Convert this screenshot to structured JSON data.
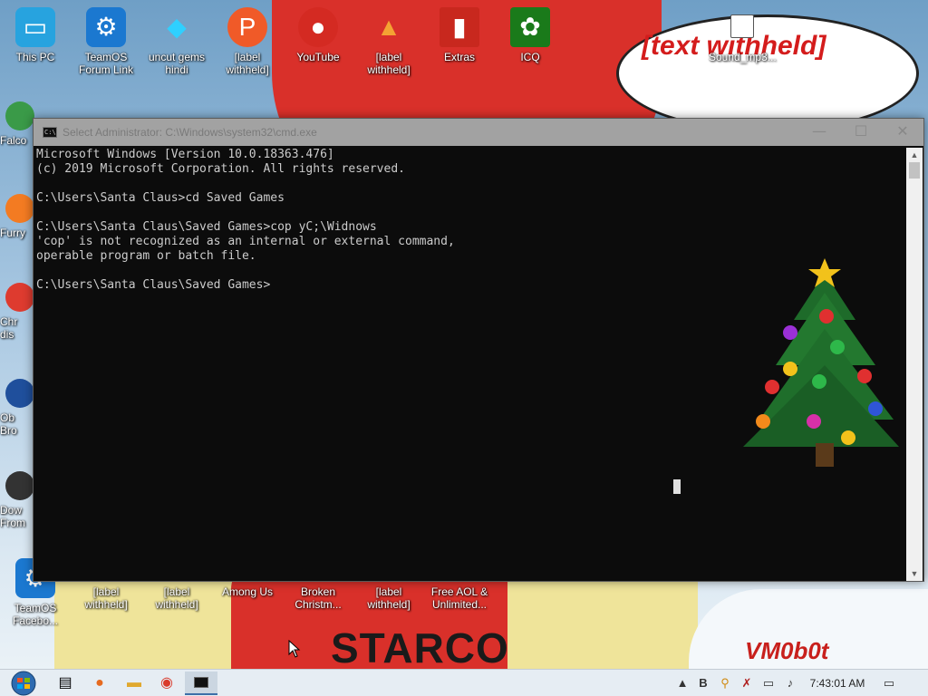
{
  "desktop": {
    "top_icons": [
      {
        "label": "This PC",
        "icon": "computer-icon"
      },
      {
        "label": "TeamOS Forum Link",
        "icon": "gear-icon"
      },
      {
        "label": "uncut gems hindi",
        "icon": "gem-icon"
      },
      {
        "label": "[label withheld]",
        "icon": "p-badge-icon"
      },
      {
        "label": "YouTube",
        "icon": "angry-bird-icon"
      },
      {
        "label": "[label withheld]",
        "icon": "ice-cream-icon"
      },
      {
        "label": "Extras",
        "icon": "red-book-icon"
      },
      {
        "label": "ICQ",
        "icon": "flower-icon"
      }
    ],
    "sound_icon": {
      "label": "Sound_mp3..."
    },
    "left_partial_icons": [
      {
        "label": "Falco"
      },
      {
        "label": "Furry"
      },
      {
        "label": "Chr dis"
      },
      {
        "label": "Ob Bro"
      },
      {
        "label": "Dow From"
      }
    ],
    "bottom_icons": [
      {
        "label": "TeamOS Facebo...",
        "icon": "gear-icon"
      },
      {
        "label": "[label withheld]",
        "icon": "app-icon"
      },
      {
        "label": "[label withheld]",
        "icon": "app-icon"
      },
      {
        "label": "Among Us",
        "icon": "game-icon"
      },
      {
        "label": "Broken Christm...",
        "icon": "ornament-icon"
      },
      {
        "label": "[label withheld]",
        "icon": "file-icon"
      },
      {
        "label": "Free AOL & Unlimited...",
        "icon": "aol-icon"
      }
    ]
  },
  "wallpaper": {
    "bubble_text": "[text withheld]",
    "signature": "VM0b0t",
    "banner_word": "STARCO"
  },
  "cmd_window": {
    "title": "Select Administrator: C:\\Windows\\system32\\cmd.exe",
    "minimize": "—",
    "maximize": "☐",
    "close": "✕",
    "lines": [
      "Microsoft Windows [Version 10.0.18363.476]",
      "(c) 2019 Microsoft Corporation. All rights reserved.",
      "",
      "C:\\Users\\Santa Claus>cd Saved Games",
      "",
      "C:\\Users\\Santa Claus\\Saved Games>cop yC;\\Widnows",
      "'cop' is not recognized as an internal or external command,",
      "operable program or batch file.",
      "",
      "C:\\Users\\Santa Claus\\Saved Games>"
    ]
  },
  "taskbar": {
    "clock": "7:43:01 AM",
    "items": [
      "task-view-icon",
      "firefox-icon",
      "file-explorer-icon",
      "chrome-icon",
      "cmd-icon"
    ],
    "tray": [
      "chevron-up-icon",
      "b-app-icon",
      "search-tool-icon",
      "x-app-icon",
      "network-icon",
      "volume-icon"
    ]
  },
  "colors": {
    "console_bg": "#0c0c0c",
    "console_text": "#cccccc",
    "bubble_text": "#d41c1c"
  }
}
